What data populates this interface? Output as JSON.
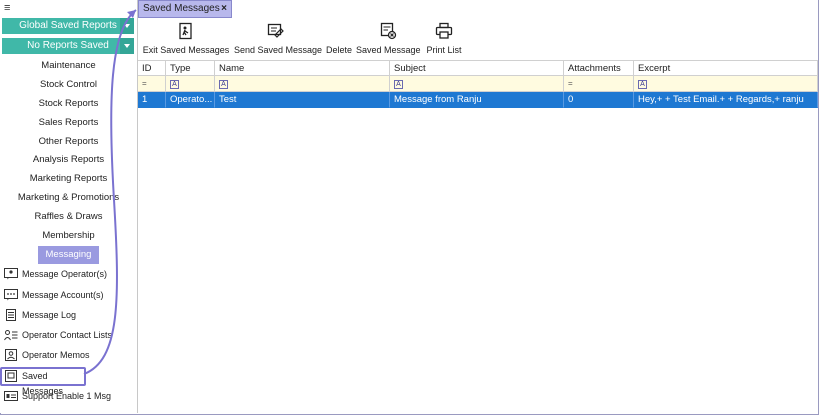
{
  "sidebar": {
    "global_reports": "Global Saved Reports",
    "no_reports": "No Reports Saved",
    "nav": [
      "Maintenance",
      "Stock Control",
      "Stock Reports",
      "Sales Reports",
      "Other Reports",
      "Analysis Reports",
      "Marketing Reports",
      "Marketing & Promotions",
      "Raffles & Draws",
      "Membership",
      "Messaging"
    ],
    "sub": [
      "Message Operator(s)",
      "Message Account(s)",
      "Message Log",
      "Operator Contact Lists",
      "Operator Memos",
      "Saved Messages",
      "Support Enable 1 Msg"
    ]
  },
  "tab": {
    "label": "Saved Messages",
    "close": "×"
  },
  "toolbar": {
    "exit": "Exit Saved Messages",
    "send": "Send Saved Message",
    "delete": "Delete",
    "saved_message": "Saved Message",
    "print": "Print List"
  },
  "grid": {
    "columns": [
      "ID",
      "Type",
      "Name",
      "Subject",
      "Attachments",
      "Excerpt"
    ],
    "filter": [
      "=",
      "A",
      "A",
      "A",
      "=",
      "A"
    ],
    "rows": [
      [
        "1",
        "Operato...",
        "Test",
        "Message from Ranju",
        "0",
        "Hey,+ + Test Email.+ + Regards,+ ranju"
      ]
    ]
  },
  "colors": {
    "teal": "#40b8a8",
    "accent": "#9a9ae0",
    "selection": "#1e78d2",
    "filter_bg": "#fffbe0"
  }
}
